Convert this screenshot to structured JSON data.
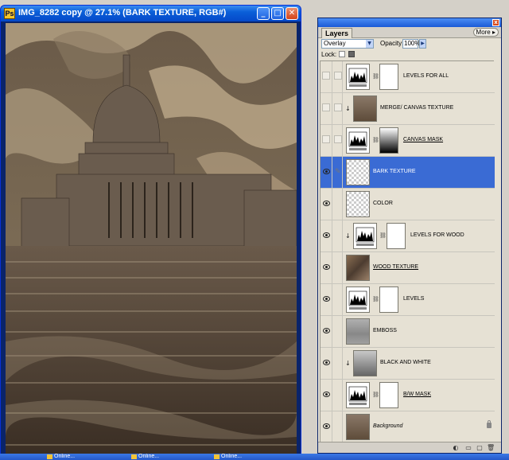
{
  "document": {
    "title": "IMG_8282 copy @ 27.1% (BARK TEXTURE, RGB#)",
    "app_icon": "photoshop-icon",
    "controls": {
      "minimize": "_",
      "maximize": "□",
      "close": "✕"
    }
  },
  "layers_panel": {
    "tab_label": "Layers",
    "more_label": "More ▸",
    "close_glyph": "x",
    "blend_mode": "Overlay",
    "opacity_label": "Opacity:",
    "opacity_value": "100%",
    "lock_label": "Lock:",
    "layers": [
      {
        "name": "LEVELS FOR ALL",
        "visible": false,
        "thumb": "levels-adjustment",
        "mask": "white",
        "clipped": false,
        "selected": false,
        "style": "normal"
      },
      {
        "name": "MERGE/ CANVAS TEXTURE",
        "visible": false,
        "thumb": "photo",
        "mask": null,
        "clipped": true,
        "selected": false,
        "style": "normal"
      },
      {
        "name": "CANVAS MASK",
        "visible": false,
        "thumb": "levels-adjustment",
        "mask": "gradient",
        "clipped": false,
        "selected": false,
        "style": "underline"
      },
      {
        "name": "BARK TEXTURE",
        "visible": true,
        "thumb": "transparent",
        "mask": null,
        "clipped": false,
        "selected": true,
        "style": "normal"
      },
      {
        "name": "COLOR",
        "visible": true,
        "thumb": "transparent-color",
        "mask": null,
        "clipped": false,
        "selected": false,
        "style": "normal"
      },
      {
        "name": "LEVELS FOR WOOD",
        "visible": true,
        "thumb": "levels-adjustment",
        "mask": "white",
        "clipped": true,
        "selected": false,
        "style": "normal"
      },
      {
        "name": "WOOD TEXTURE",
        "visible": true,
        "thumb": "wood",
        "mask": null,
        "clipped": false,
        "selected": false,
        "style": "underline"
      },
      {
        "name": "LEVELS",
        "visible": true,
        "thumb": "levels-adjustment",
        "mask": "white",
        "clipped": false,
        "selected": false,
        "style": "normal"
      },
      {
        "name": "EMBOSS",
        "visible": true,
        "thumb": "gray",
        "mask": null,
        "clipped": false,
        "selected": false,
        "style": "normal"
      },
      {
        "name": "BLACK AND WHITE",
        "visible": true,
        "thumb": "bw-photo",
        "mask": null,
        "clipped": true,
        "selected": false,
        "style": "normal"
      },
      {
        "name": "B/W MASK",
        "visible": true,
        "thumb": "levels-adjustment",
        "mask": "white",
        "clipped": false,
        "selected": false,
        "style": "underline"
      },
      {
        "name": "Background",
        "visible": true,
        "thumb": "photo",
        "mask": null,
        "clipped": false,
        "selected": false,
        "style": "italic",
        "locked": true
      }
    ],
    "bottom_icons": [
      "adjustment-layer-icon",
      "new-group-icon",
      "new-layer-icon",
      "trash-icon"
    ]
  },
  "taskbar": {
    "items": [
      "Online...",
      "Online...",
      "Online..."
    ]
  },
  "colors": {
    "titlebar": "#0a5fd8",
    "panel_bg": "#e6e1d4",
    "selection": "#3a6bd4"
  }
}
